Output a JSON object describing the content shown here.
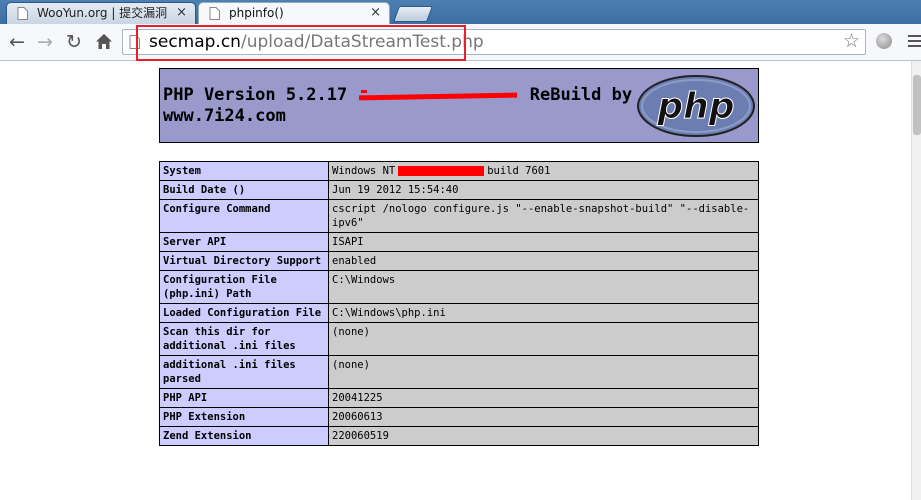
{
  "browser": {
    "tabs": [
      {
        "title": "WooYun.org | 提交漏洞",
        "active": false
      },
      {
        "title": "phpinfo()",
        "active": true
      }
    ],
    "url": {
      "host": "secmap.cn",
      "path": "/upload/DataStreamTest.php"
    }
  },
  "php": {
    "title_prefix": "PHP Version 5.2.17",
    "title_suffix": "ReBuild by",
    "title_line2": "www.7i24.com",
    "logo_text": "php"
  },
  "table": [
    {
      "label": "System",
      "value_before": "Windows NT",
      "value_after": "build 7601"
    },
    {
      "label": "Build Date ()",
      "value_before": "Jun 19 2012 15:54:40"
    },
    {
      "label": "Configure Command",
      "value_before": "cscript /nologo configure.js \"--enable-snapshot-build\" \"--disable-ipv6\""
    },
    {
      "label": "Server API",
      "value_before": "ISAPI"
    },
    {
      "label": "Virtual Directory Support",
      "value_before": "enabled"
    },
    {
      "label": "Configuration File (php.ini) Path",
      "value_before": "C:\\Windows"
    },
    {
      "label": "Loaded Configuration File",
      "value_before": "C:\\Windows\\php.ini"
    },
    {
      "label": "Scan this dir for additional .ini files",
      "value_before": "(none)"
    },
    {
      "label": "additional .ini files parsed",
      "value_before": "(none)"
    },
    {
      "label": "PHP API",
      "value_before": "20041225"
    },
    {
      "label": "PHP Extension",
      "value_before": "20060613"
    },
    {
      "label": "Zend Extension",
      "value_before": "220060519"
    }
  ]
}
